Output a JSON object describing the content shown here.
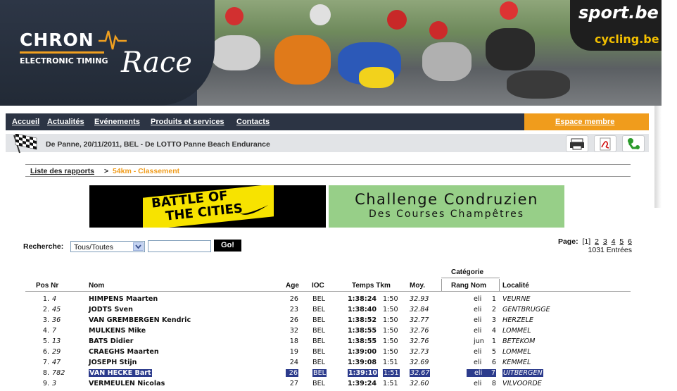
{
  "header": {
    "logo_chrono": "CHRON",
    "logo_subtitle": "ELECTRONIC TIMING",
    "logo_race": "Race",
    "sport_logo": "sport.be",
    "cycling_logo": "cycling.be"
  },
  "nav": {
    "items": [
      {
        "label": "Accueil"
      },
      {
        "label": "Actualités"
      },
      {
        "label": "Evénements"
      },
      {
        "label": "Produits et services"
      },
      {
        "label": "Contacts"
      }
    ],
    "member_label": "Espace membre"
  },
  "event": {
    "title": "De Panne, 20/11/2011, BEL - De LOTTO Panne Beach Endurance",
    "tools": [
      "printer-icon",
      "pdf-icon",
      "excel-icon"
    ]
  },
  "breadcrumb": {
    "link": "Liste des rapports",
    "separator": ">",
    "current": "54km - Classement",
    "current_color": "#f09c1c"
  },
  "ads": {
    "battle_line1": "BATTLE OF",
    "battle_line2": "THE CITIES",
    "challenge_line1": "Challenge Condruzien",
    "challenge_line2": "Des Courses Champêtres"
  },
  "search": {
    "label": "Recherche:",
    "filter_value": "Tous/Toutes",
    "input_value": "",
    "go_label": "Go!"
  },
  "pager": {
    "label": "Page:",
    "current": "[1]",
    "pages": [
      "2",
      "3",
      "4",
      "5",
      "6"
    ],
    "entries": "1031 Entrées"
  },
  "table": {
    "category_group": "Catégorie",
    "headers": {
      "pos_nr": "Pos Nr",
      "nom": "Nom",
      "age": "Age",
      "ioc": "IOC",
      "temps_tkm": "Temps Tkm",
      "moy": "Moy.",
      "rang_nom": "Rang Nom",
      "localite": "Localité"
    },
    "rows": [
      {
        "pos": "1.",
        "nr": "4",
        "nom": "HIMPENS Maarten",
        "age": "26",
        "ioc": "BEL",
        "temps": "1:38:24",
        "tkm": "1:50",
        "moy": "32.93",
        "rang": "1",
        "cat": "eli",
        "loc": "VEURNE",
        "selected": false
      },
      {
        "pos": "2.",
        "nr": "45",
        "nom": "JODTS Sven",
        "age": "23",
        "ioc": "BEL",
        "temps": "1:38:40",
        "tkm": "1:50",
        "moy": "32.84",
        "rang": "2",
        "cat": "eli",
        "loc": "GENTBRUGGE",
        "selected": false
      },
      {
        "pos": "3.",
        "nr": "36",
        "nom": "VAN GREMBERGEN Kendric",
        "age": "26",
        "ioc": "BEL",
        "temps": "1:38:52",
        "tkm": "1:50",
        "moy": "32.77",
        "rang": "3",
        "cat": "eli",
        "loc": "HERZELE",
        "selected": false
      },
      {
        "pos": "4.",
        "nr": "7",
        "nom": "MULKENS Mike",
        "age": "32",
        "ioc": "BEL",
        "temps": "1:38:55",
        "tkm": "1:50",
        "moy": "32.76",
        "rang": "4",
        "cat": "eli",
        "loc": "LOMMEL",
        "selected": false
      },
      {
        "pos": "5.",
        "nr": "13",
        "nom": "BATS Didier",
        "age": "18",
        "ioc": "BEL",
        "temps": "1:38:55",
        "tkm": "1:50",
        "moy": "32.76",
        "rang": "1",
        "cat": "jun",
        "loc": "BETEKOM",
        "selected": false
      },
      {
        "pos": "6.",
        "nr": "29",
        "nom": "CRAEGHS Maarten",
        "age": "19",
        "ioc": "BEL",
        "temps": "1:39:00",
        "tkm": "1:50",
        "moy": "32.73",
        "rang": "5",
        "cat": "eli",
        "loc": "LOMMEL",
        "selected": false
      },
      {
        "pos": "7.",
        "nr": "47",
        "nom": "JOSEPH Stijn",
        "age": "24",
        "ioc": "BEL",
        "temps": "1:39:08",
        "tkm": "1:51",
        "moy": "32.69",
        "rang": "6",
        "cat": "eli",
        "loc": "KEMMEL",
        "selected": false
      },
      {
        "pos": "8.",
        "nr": "782",
        "nom": "VAN HECKE Bart",
        "age": "26",
        "ioc": "BEL",
        "temps": "1:39:10",
        "tkm": "1:51",
        "moy": "32.67",
        "rang": "7",
        "cat": "eli",
        "loc": "UITBERGEN",
        "selected": true
      },
      {
        "pos": "9.",
        "nr": "3",
        "nom": "VERMEULEN Nicolas",
        "age": "27",
        "ioc": "BEL",
        "temps": "1:39:24",
        "tkm": "1:51",
        "moy": "32.60",
        "rang": "8",
        "cat": "eli",
        "loc": "VILVOORDE",
        "selected": false
      }
    ]
  },
  "colors": {
    "nav_bg": "#2c3444",
    "accent_orange": "#f09c1c",
    "selection": "#2c3b8c"
  }
}
